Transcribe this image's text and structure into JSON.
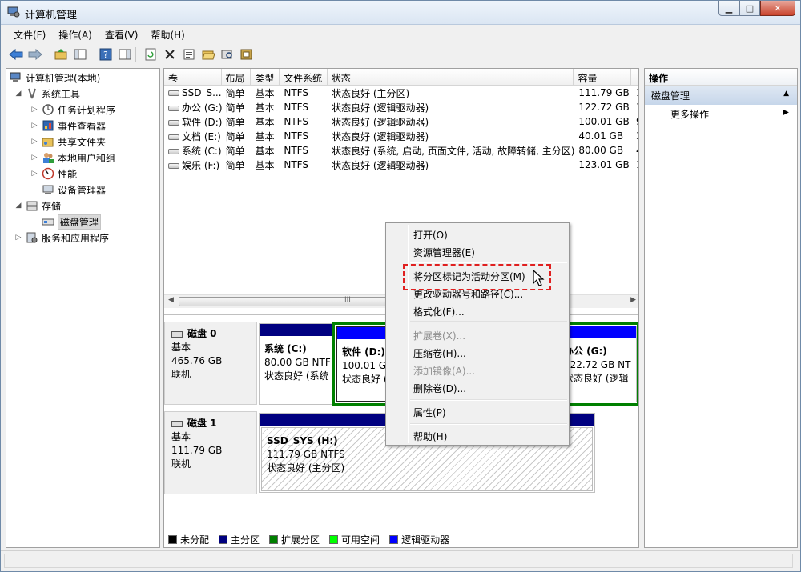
{
  "window": {
    "title": "计算机管理",
    "buttons": [
      "▁",
      "□",
      "✕"
    ]
  },
  "menubar": [
    "文件(F)",
    "操作(A)",
    "查看(V)",
    "帮助(H)"
  ],
  "tree": {
    "root": "计算机管理(本地)",
    "system_tools": "系统工具",
    "task_scheduler": "任务计划程序",
    "event_viewer": "事件查看器",
    "shared_folders": "共享文件夹",
    "local_users": "本地用户和组",
    "performance": "性能",
    "device_manager": "设备管理器",
    "storage": "存储",
    "disk_management": "磁盘管理",
    "services": "服务和应用程序"
  },
  "volume_table": {
    "headers": [
      "卷",
      "布局",
      "类型",
      "文件系统",
      "状态",
      "容量",
      ""
    ],
    "rows": [
      {
        "vol": "SSD_S...",
        "layout": "简单",
        "type": "基本",
        "fs": "NTFS",
        "status": "状态良好 (主分区)",
        "capacity": "111.79 GB",
        "extra": "1"
      },
      {
        "vol": "办公 (G:)",
        "layout": "简单",
        "type": "基本",
        "fs": "NTFS",
        "status": "状态良好 (逻辑驱动器)",
        "capacity": "122.72 GB",
        "extra": "1"
      },
      {
        "vol": "软件 (D:)",
        "layout": "简单",
        "type": "基本",
        "fs": "NTFS",
        "status": "状态良好 (逻辑驱动器)",
        "capacity": "100.01 GB",
        "extra": "9"
      },
      {
        "vol": "文档 (E:)",
        "layout": "简单",
        "type": "基本",
        "fs": "NTFS",
        "status": "状态良好 (逻辑驱动器)",
        "capacity": "40.01 GB",
        "extra": "3"
      },
      {
        "vol": "系统 (C:)",
        "layout": "简单",
        "type": "基本",
        "fs": "NTFS",
        "status": "状态良好 (系统, 启动, 页面文件, 活动, 故障转储, 主分区)",
        "capacity": "80.00 GB",
        "extra": "4"
      },
      {
        "vol": "娱乐 (F:)",
        "layout": "简单",
        "type": "基本",
        "fs": "NTFS",
        "status": "状态良好 (逻辑驱动器)",
        "capacity": "123.01 GB",
        "extra": "1"
      }
    ]
  },
  "scrollbar_label": "III",
  "disks": [
    {
      "name": "磁盘 0",
      "type": "基本",
      "size": "465.76 GB",
      "state": "联机",
      "partitions": [
        {
          "name": "系统  (C:)",
          "size": "80.00 GB NTF",
          "status": "状态良好 (系统"
        },
        {
          "name": "软件  (D:)",
          "size": "100.01 GB",
          "status": "状态良好 ("
        },
        {
          "name": "办公  (G:)",
          "size": "122.72 GB NT",
          "status": "状态良好 (逻辑"
        }
      ]
    },
    {
      "name": "磁盘 1",
      "type": "基本",
      "size": "111.79 GB",
      "state": "联机",
      "partitions": [
        {
          "name": "SSD_SYS  (H:)",
          "size": "111.79 GB NTFS",
          "status": "状态良好 (主分区)"
        }
      ]
    }
  ],
  "legend": [
    {
      "label": "未分配",
      "color": "#000000"
    },
    {
      "label": "主分区",
      "color": "#00007f"
    },
    {
      "label": "扩展分区",
      "color": "#007f00"
    },
    {
      "label": "可用空间",
      "color": "#00ff00"
    },
    {
      "label": "逻辑驱动器",
      "color": "#0000ff"
    }
  ],
  "colors": {
    "primary_bar": "#000080",
    "logical_bar": "#0000ff",
    "extended_border": "#008000"
  },
  "actions": {
    "header": "操作",
    "section": "磁盘管理",
    "more": "更多操作"
  },
  "context_menu": {
    "open": "打开(O)",
    "explorer": "资源管理器(E)",
    "mark_active": "将分区标记为活动分区(M)",
    "change_letter": "更改驱动器号和路径(C)...",
    "format": "格式化(F)...",
    "extend": "扩展卷(X)...",
    "shrink": "压缩卷(H)...",
    "add_mirror": "添加镜像(A)...",
    "delete": "删除卷(D)...",
    "properties": "属性(P)",
    "help": "帮助(H)"
  }
}
